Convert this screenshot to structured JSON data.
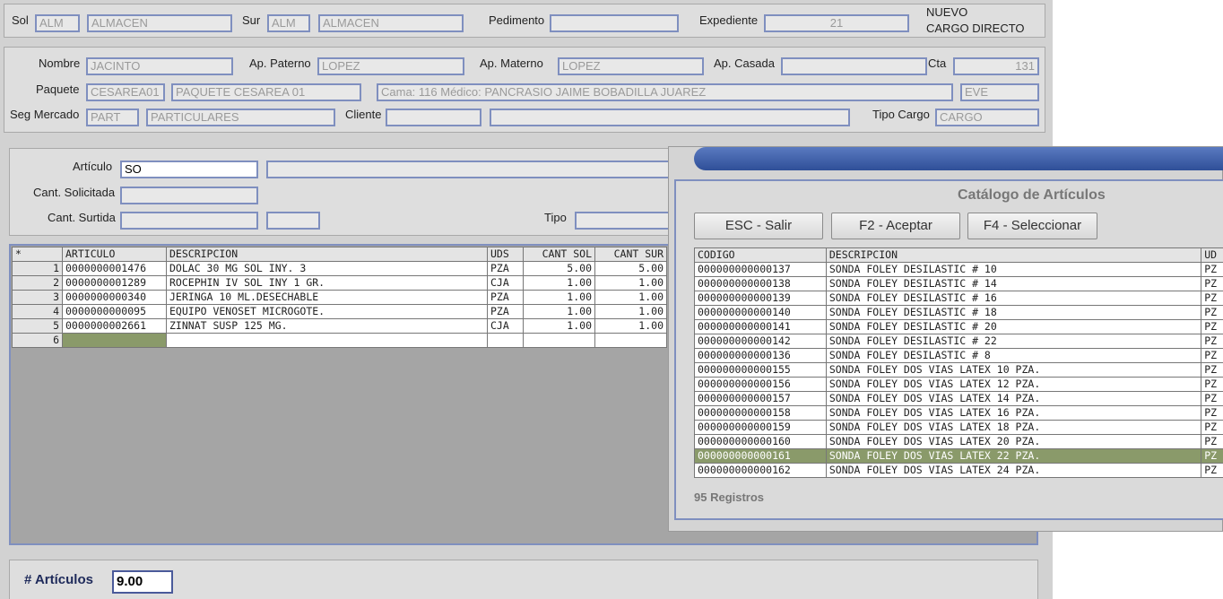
{
  "header": {
    "sol_label": "Sol",
    "sol_code": "ALM",
    "sol_name": "ALMACEN",
    "sur_label": "Sur",
    "sur_code": "ALM",
    "sur_name": "ALMACEN",
    "pedimento_label": "Pedimento",
    "pedimento_value": "",
    "expediente_label": "Expediente",
    "expediente_value": "21",
    "status_line1": "NUEVO",
    "status_line2": "CARGO DIRECTO"
  },
  "patient": {
    "nombre_label": "Nombre",
    "nombre": "JACINTO",
    "ap_paterno_label": "Ap. Paterno",
    "ap_paterno": "LOPEZ",
    "ap_materno_label": "Ap. Materno",
    "ap_materno": "LOPEZ",
    "ap_casada_label": "Ap. Casada",
    "ap_casada": "",
    "cta_label": "Cta",
    "cta": "131",
    "paquete_label": "Paquete",
    "paquete_code": "CESAREA01",
    "paquete_name": "PAQUETE CESAREA 01",
    "cama_medico": "Cama: 116  Médico: PANCRASIO JAIME BOBADILLA JUAREZ",
    "eve": "EVE",
    "seg_mercado_label": "Seg Mercado",
    "seg_code": "PART",
    "seg_name": "PARTICULARES",
    "cliente_label": "Cliente",
    "cliente_code": "",
    "cliente_name": "",
    "tipo_cargo_label": "Tipo Cargo",
    "tipo_cargo": "CARGO"
  },
  "article": {
    "articulo_label": "Artículo",
    "articulo_value": "SO",
    "cant_solicitada_label": "Cant. Solicitada",
    "cant_surtida_label": "Cant. Surtida",
    "tipo_label": "Tipo"
  },
  "grid": {
    "headers": [
      "*",
      "ARTICULO",
      "DESCRIPCION",
      "UDS",
      "CANT SOL",
      "CANT SUR"
    ],
    "rows": [
      [
        "1",
        "0000000001476",
        "DOLAC 30 MG SOL INY. 3",
        "PZA",
        "5.00",
        "5.00"
      ],
      [
        "2",
        "0000000001289",
        "ROCEPHIN IV SOL INY 1 GR.",
        "CJA",
        "1.00",
        "1.00"
      ],
      [
        "3",
        "0000000000340",
        "JERINGA 10 ML.DESECHABLE",
        "PZA",
        "1.00",
        "1.00"
      ],
      [
        "4",
        "0000000000095",
        "EQUIPO VENOSET MICROGOTE.",
        "PZA",
        "1.00",
        "1.00"
      ],
      [
        "5",
        "0000000002661",
        "ZINNAT SUSP 125 MG.",
        "CJA",
        "1.00",
        "1.00"
      ],
      [
        "6",
        "",
        "",
        "",
        "",
        ""
      ]
    ]
  },
  "footer": {
    "articulos_label": "# Artículos",
    "articulos_value": "9.00"
  },
  "catalog": {
    "title": "Catálogo de Artículos",
    "btn_esc": "ESC - Salir",
    "btn_f2": "F2 - Aceptar",
    "btn_f4": "F4 - Seleccionar",
    "headers": [
      "CODIGO",
      "DESCRIPCION",
      "UD"
    ],
    "rows": [
      [
        "000000000000137",
        "SONDA FOLEY DESILASTIC # 10",
        "PZ"
      ],
      [
        "000000000000138",
        "SONDA FOLEY DESILASTIC # 14",
        "PZ"
      ],
      [
        "000000000000139",
        "SONDA FOLEY DESILASTIC # 16",
        "PZ"
      ],
      [
        "000000000000140",
        "SONDA FOLEY DESILASTIC # 18",
        "PZ"
      ],
      [
        "000000000000141",
        "SONDA FOLEY DESILASTIC # 20",
        "PZ"
      ],
      [
        "000000000000142",
        "SONDA FOLEY DESILASTIC # 22",
        "PZ"
      ],
      [
        "000000000000136",
        "SONDA FOLEY DESILASTIC # 8",
        "PZ"
      ],
      [
        "000000000000155",
        "SONDA FOLEY DOS VIAS LATEX 10 PZA.",
        "PZ"
      ],
      [
        "000000000000156",
        "SONDA FOLEY DOS VIAS LATEX 12 PZA.",
        "PZ"
      ],
      [
        "000000000000157",
        "SONDA FOLEY DOS VIAS LATEX 14 PZA.",
        "PZ"
      ],
      [
        "000000000000158",
        "SONDA FOLEY DOS VIAS LATEX 16 PZA.",
        "PZ"
      ],
      [
        "000000000000159",
        "SONDA FOLEY DOS VIAS LATEX 18 PZA.",
        "PZ"
      ],
      [
        "000000000000160",
        "SONDA FOLEY DOS VIAS LATEX 20 PZA.",
        "PZ"
      ],
      [
        "000000000000161",
        "SONDA FOLEY DOS VIAS LATEX 22 PZA.",
        "PZ"
      ],
      [
        "000000000000162",
        "SONDA FOLEY DOS VIAS LATEX 24 PZA.",
        "PZ"
      ]
    ],
    "selected_index": 13,
    "count_label": "95 Registros"
  },
  "colors": {
    "field_border": "#7f8fbf",
    "selected_row": "#8a9a6a",
    "title_bar": "#3f5fa8"
  }
}
